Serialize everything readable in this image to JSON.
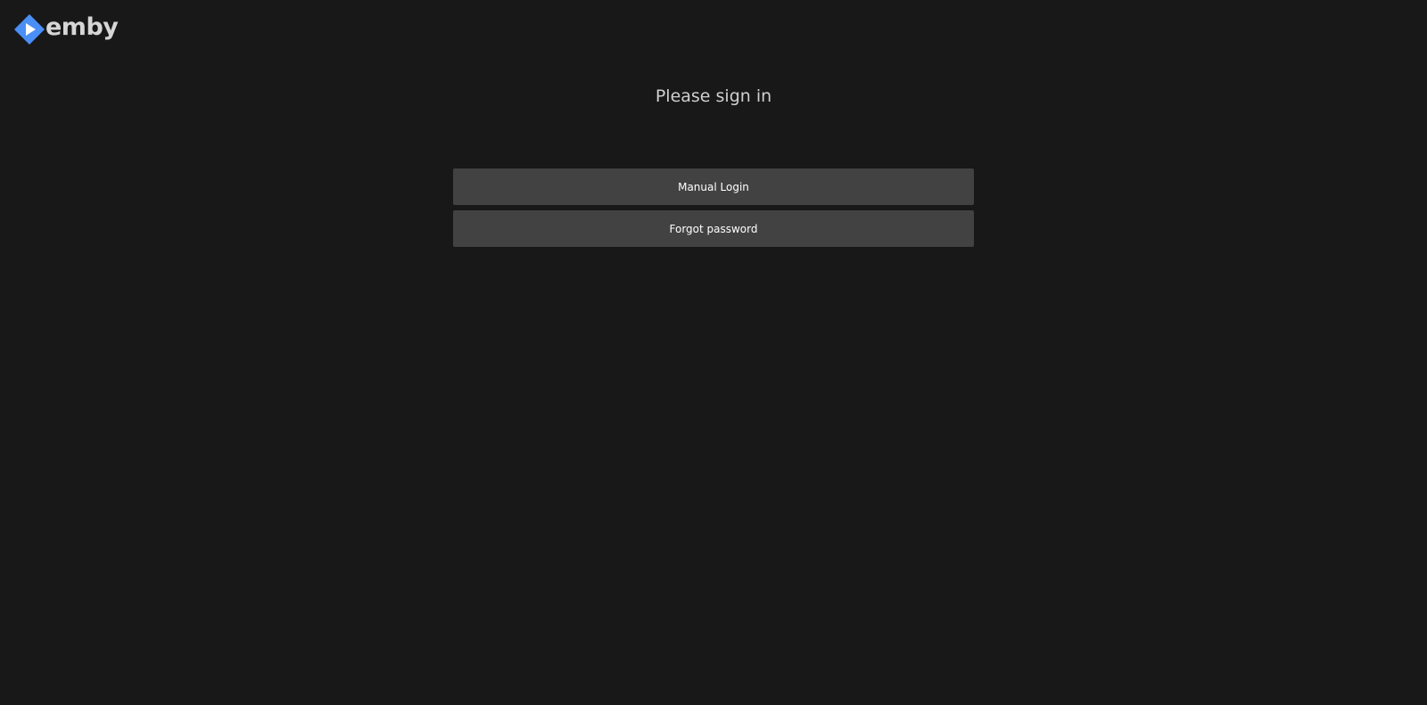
{
  "brand": {
    "name": "emby",
    "logo_icon": "emby-play-diamond-icon",
    "accent_color": "#52b54b",
    "logo_color": "#4a8ff5"
  },
  "login": {
    "title": "Please sign in",
    "buttons": [
      {
        "label": "Manual Login",
        "icon": null
      },
      {
        "label": "Forgot password",
        "icon": null
      }
    ]
  },
  "theme": {
    "background": "#181818",
    "button_background": "#424242",
    "text_color": "#ffffff",
    "title_color": "#cfcfcf"
  }
}
